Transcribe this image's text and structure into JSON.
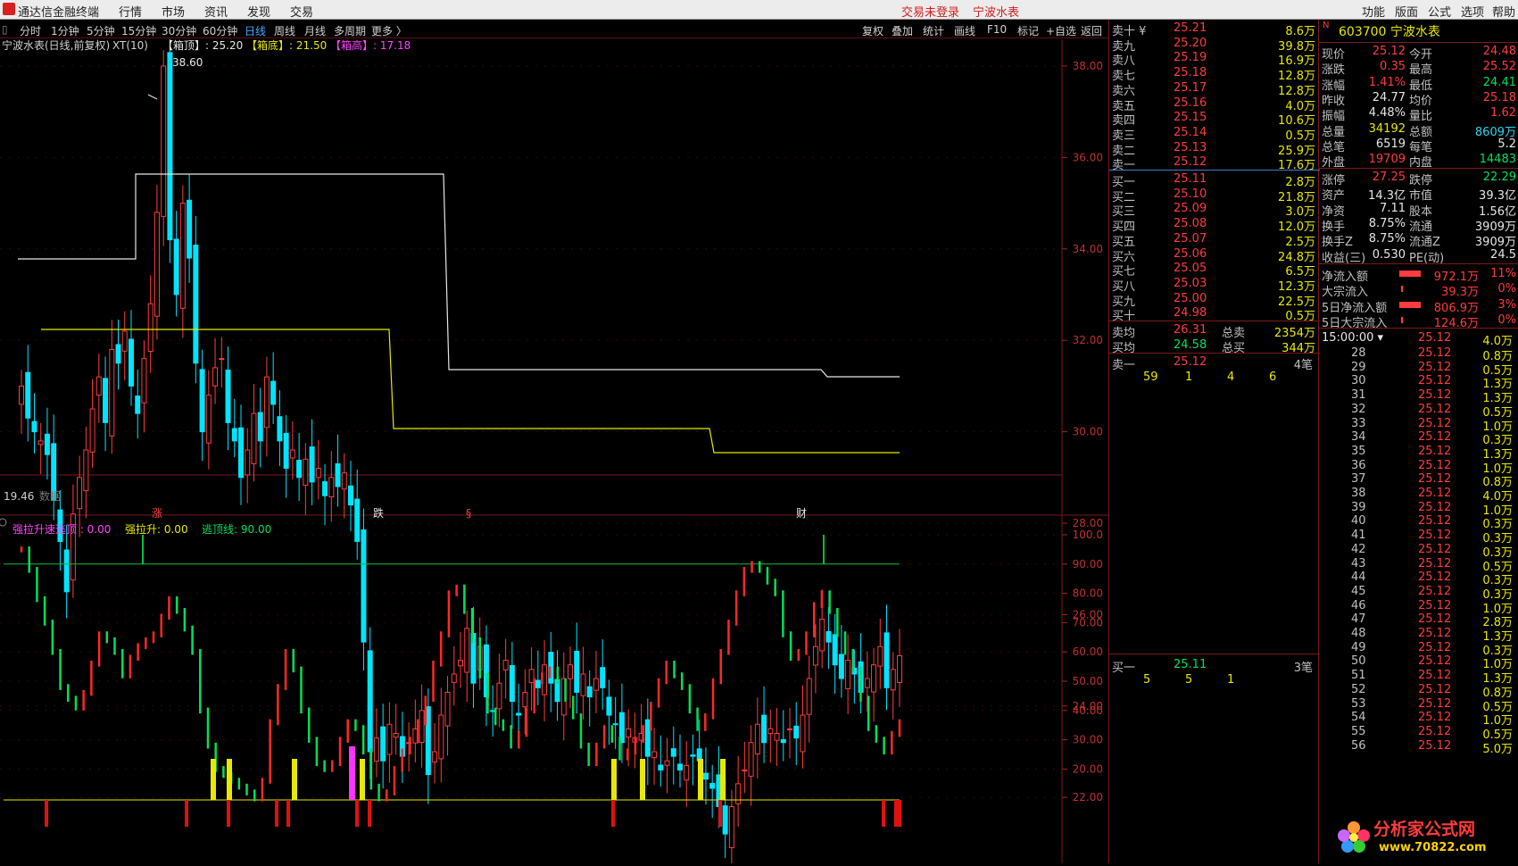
{
  "topbar": {
    "app_title": "通达信金融终端",
    "menu": [
      "行情",
      "市场",
      "资讯",
      "发现",
      "交易"
    ],
    "status1": "交易未登录",
    "status2": "宁波水表",
    "right_menu": [
      "功能",
      "版面",
      "公式",
      "选项",
      "帮助"
    ]
  },
  "toolbar": {
    "periods": [
      "分时",
      "1分钟",
      "5分钟",
      "15分钟",
      "30分钟",
      "60分钟",
      "日线",
      "周线",
      "月线",
      "多周期",
      "更多 〉"
    ],
    "active": "日线",
    "right": [
      "复权",
      "叠加",
      "统计",
      "画线",
      "F10",
      "标记",
      "+自选",
      "返回"
    ]
  },
  "main_chart": {
    "title": "宁波水表(日线,前复权)",
    "indicator": "XT(10)",
    "box_top": "【箱顶】: 25.20",
    "box_bottom": "【箱底】: 21.50",
    "box_high": "【箱高】: 17.18",
    "high_label": "38.60",
    "low_label": "19.46",
    "no_data": "数据",
    "markers": [
      "涨",
      "跌",
      "§",
      "财"
    ],
    "yaxis": [
      "38.00",
      "36.00",
      "34.00",
      "32.00",
      "30.00",
      "28.00",
      "26.00",
      "24.00",
      "22.00",
      "20.00"
    ]
  },
  "sub_chart": {
    "title": "强拉升速逃顶 : 0.00",
    "line2": "强拉升: 0.00",
    "line3": "逃顶线: 90.00",
    "yaxis": [
      "100.0",
      "90.00",
      "80.00",
      "70.00",
      "60.00",
      "50.00",
      "40.00",
      "30.00",
      "20.00"
    ]
  },
  "colors": {
    "up": "#ff3c3c",
    "down": "#00e5ff",
    "green": "#00e05a",
    "yellow": "#e8e800",
    "magenta": "#ff33ff",
    "grid": "#5a1010",
    "bg": "#000000"
  },
  "orderbook": {
    "sell": [
      [
        "卖十 ¥",
        "25.21",
        "8.6万"
      ],
      [
        "卖九",
        "25.20",
        "39.8万"
      ],
      [
        "卖八",
        "25.19",
        "16.9万"
      ],
      [
        "卖七",
        "25.18",
        "12.8万"
      ],
      [
        "卖六",
        "25.17",
        "12.8万"
      ],
      [
        "卖五",
        "25.16",
        "4.0万"
      ],
      [
        "卖四",
        "25.15",
        "10.6万"
      ],
      [
        "卖三",
        "25.14",
        "0.5万"
      ],
      [
        "卖二",
        "25.13",
        "25.9万"
      ],
      [
        "卖一",
        "25.12",
        "17.6万"
      ]
    ],
    "buy": [
      [
        "买一",
        "25.11",
        "2.8万"
      ],
      [
        "买二",
        "25.10",
        "21.8万"
      ],
      [
        "买三",
        "25.09",
        "3.0万"
      ],
      [
        "买四",
        "25.08",
        "12.0万"
      ],
      [
        "买五",
        "25.07",
        "2.5万"
      ],
      [
        "买六",
        "25.06",
        "24.8万"
      ],
      [
        "买七",
        "25.05",
        "6.5万"
      ],
      [
        "买八",
        "25.03",
        "12.3万"
      ],
      [
        "买九",
        "25.00",
        "22.5万"
      ],
      [
        "买十",
        "24.98",
        "0.5万"
      ]
    ],
    "avg": [
      [
        "卖均",
        "26.31",
        "总卖",
        "2354万"
      ],
      [
        "买均",
        "24.58",
        "总买",
        "344万"
      ]
    ],
    "sell1_detail": {
      "label": "卖一",
      "price": "25.12",
      "count": "4笔",
      "queue": [
        "59",
        "1",
        "4",
        "6"
      ]
    },
    "buy1_detail": {
      "label": "买一",
      "price": "25.11",
      "count": "3笔",
      "queue": [
        "5",
        "5",
        "1"
      ]
    }
  },
  "quote": {
    "code_line": "603700 宁波水表",
    "badge": "N",
    "rows": [
      [
        "现价",
        "25.12",
        "今开",
        "24.48"
      ],
      [
        "涨跌",
        "0.35",
        "最高",
        "25.52"
      ],
      [
        "涨幅",
        "1.41%",
        "最低",
        "24.41"
      ],
      [
        "昨收",
        "24.77",
        "均价",
        "25.18"
      ],
      [
        "振幅",
        "4.48%",
        "量比",
        "1.62"
      ],
      [
        "总量",
        "34192",
        "总额",
        "8609万"
      ],
      [
        "总笔",
        "6519",
        "每笔",
        "5.2"
      ],
      [
        "外盘",
        "19709",
        "内盘",
        "14483"
      ]
    ],
    "rows2": [
      [
        "涨停",
        "27.25",
        "跌停",
        "22.29"
      ],
      [
        "资产",
        "14.3亿",
        "市值",
        "39.3亿"
      ],
      [
        "净资",
        "7.11",
        "股本",
        "1.56亿"
      ],
      [
        "换手",
        "8.75%",
        "流通",
        "3909万"
      ],
      [
        "换手Z",
        "8.75%",
        "流通Z",
        "3909万"
      ],
      [
        "收益(三)",
        "0.530",
        "PE(动)",
        "24.5"
      ]
    ],
    "flows": [
      [
        "净流入额",
        "972.1万",
        "11%"
      ],
      [
        "大宗流入",
        "39.3万",
        "0%"
      ],
      [
        "5日净流入额",
        "806.9万",
        "3%"
      ],
      [
        "5日大宗流入",
        "124.6万",
        "0%"
      ]
    ],
    "tick_header": "15:00:00",
    "ticks": [
      [
        "28",
        "25.12",
        "0.8万"
      ],
      [
        "29",
        "25.12",
        "0.5万"
      ],
      [
        "30",
        "25.12",
        "1.3万"
      ],
      [
        "31",
        "25.12",
        "1.3万"
      ],
      [
        "32",
        "25.12",
        "0.5万"
      ],
      [
        "33",
        "25.12",
        "1.0万"
      ],
      [
        "34",
        "25.12",
        "0.3万"
      ],
      [
        "35",
        "25.12",
        "1.3万"
      ],
      [
        "36",
        "25.12",
        "1.0万"
      ],
      [
        "37",
        "25.12",
        "0.8万"
      ],
      [
        "38",
        "25.12",
        "4.0万"
      ],
      [
        "39",
        "25.12",
        "1.0万"
      ],
      [
        "40",
        "25.12",
        "0.3万"
      ],
      [
        "41",
        "25.12",
        "0.3万"
      ],
      [
        "42",
        "25.12",
        "0.3万"
      ],
      [
        "43",
        "25.12",
        "0.5万"
      ],
      [
        "44",
        "25.12",
        "0.3万"
      ],
      [
        "45",
        "25.12",
        "0.3万"
      ],
      [
        "46",
        "25.12",
        "1.0万"
      ],
      [
        "47",
        "25.12",
        "2.8万"
      ],
      [
        "48",
        "25.12",
        "1.3万"
      ],
      [
        "49",
        "25.12",
        "0.3万"
      ],
      [
        "50",
        "25.12",
        "1.0万"
      ],
      [
        "51",
        "25.12",
        "1.3万"
      ],
      [
        "52",
        "25.12",
        "0.8万"
      ],
      [
        "53",
        "25.12",
        "0.5万"
      ],
      [
        "54",
        "25.12",
        "1.0万"
      ],
      [
        "55",
        "25.12",
        "0.5万"
      ],
      [
        "56",
        "25.12",
        "5.0万"
      ]
    ],
    "tick_first": "4.0万"
  },
  "watermark": {
    "text": "分析家公式网",
    "url": "www.70822.com"
  }
}
